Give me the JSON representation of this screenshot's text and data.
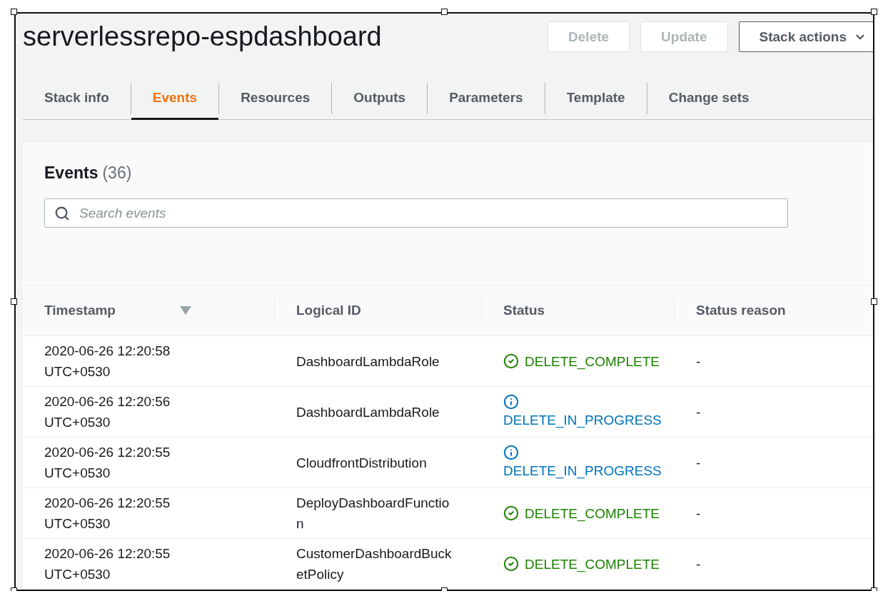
{
  "title": "serverlessrepo-espdashboard",
  "actions": [
    {
      "label": "Delete",
      "disabled": true
    },
    {
      "label": "Update",
      "disabled": true
    },
    {
      "label": "Stack actions",
      "disabled": false
    }
  ],
  "tabs": [
    {
      "label": "Stack info",
      "selected": false
    },
    {
      "label": "Events",
      "selected": true
    },
    {
      "label": "Resources",
      "selected": false
    },
    {
      "label": "Outputs",
      "selected": false
    },
    {
      "label": "Parameters",
      "selected": false
    },
    {
      "label": "Template",
      "selected": false
    },
    {
      "label": "Change sets",
      "selected": false
    }
  ],
  "events": {
    "heading": "Events",
    "count": "(36)",
    "search": {
      "placeholder": "Search events"
    },
    "columns": [
      "Timestamp",
      "Logical ID",
      "Status",
      "Status reason"
    ],
    "rows": [
      {
        "timestamp": "2020-06-26 12:20:58 UTC+0530",
        "logical_id": "DashboardLambdaRole",
        "status": {
          "kind": "complete",
          "text": "DELETE_COMPLETE"
        },
        "reason": "-"
      },
      {
        "timestamp": "2020-06-26 12:20:56 UTC+0530",
        "logical_id": "DashboardLambdaRole",
        "status": {
          "kind": "in_progress",
          "text": "DELETE_IN_PROGRESS"
        },
        "reason": "-"
      },
      {
        "timestamp": "2020-06-26 12:20:55 UTC+0530",
        "logical_id": "CloudfrontDistribution",
        "status": {
          "kind": "in_progress",
          "text": "DELETE_IN_PROGRESS"
        },
        "reason": "-"
      },
      {
        "timestamp": "2020-06-26 12:20:55 UTC+0530",
        "logical_id": "DeployDashboardFunction",
        "status": {
          "kind": "complete",
          "text": "DELETE_COMPLETE"
        },
        "reason": "-"
      },
      {
        "timestamp": "2020-06-26 12:20:55 UTC+0530",
        "logical_id": "CustomerDashboardBucketPolicy",
        "status": {
          "kind": "complete",
          "text": "DELETE_COMPLETE"
        },
        "reason": "-"
      }
    ]
  }
}
